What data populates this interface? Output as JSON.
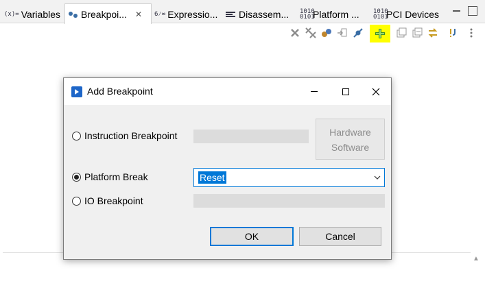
{
  "tabs": [
    {
      "label": "Variables",
      "icon": "variables-icon",
      "glyph": "(x)="
    },
    {
      "label": "Breakpoi...",
      "icon": "breakpoints-icon",
      "active": true,
      "close": "✕"
    },
    {
      "label": "Expressio...",
      "icon": "expressions-icon",
      "glyph": "6⁄∞"
    },
    {
      "label": "Disassem...",
      "icon": "disassembly-icon"
    },
    {
      "label": "Platform ...",
      "icon": "platform-icon",
      "glyph": "1010 0101"
    },
    {
      "label": "PCI Devices",
      "icon": "pci-devices-icon",
      "glyph": "1010 0101"
    }
  ],
  "toolbar": {
    "buttons": [
      "remove-breakpoint-icon",
      "remove-all-breakpoints-icon",
      "show-supported-breakpoints-icon",
      "go-to-file-icon",
      "skip-all-breakpoints-icon",
      "add-breakpoint-icon",
      "expand-all-icon",
      "collapse-all-icon",
      "link-with-debug-view-icon",
      "breakpoint-properties-icon",
      "view-menu-icon"
    ],
    "highlight_color": "#ffff00"
  },
  "dialog": {
    "title": "Add Breakpoint",
    "options": {
      "instruction": {
        "label": "Instruction Breakpoint",
        "checked": false
      },
      "platform": {
        "label": "Platform Break",
        "checked": true
      },
      "io": {
        "label": "IO Breakpoint",
        "checked": false
      }
    },
    "hw_sw": {
      "hardware": "Hardware",
      "software": "Software"
    },
    "platform_select": {
      "value": "Reset"
    },
    "ok_label": "OK",
    "cancel_label": "Cancel"
  },
  "colors": {
    "accent": "#0078d7",
    "highlight": "#ffff00"
  }
}
